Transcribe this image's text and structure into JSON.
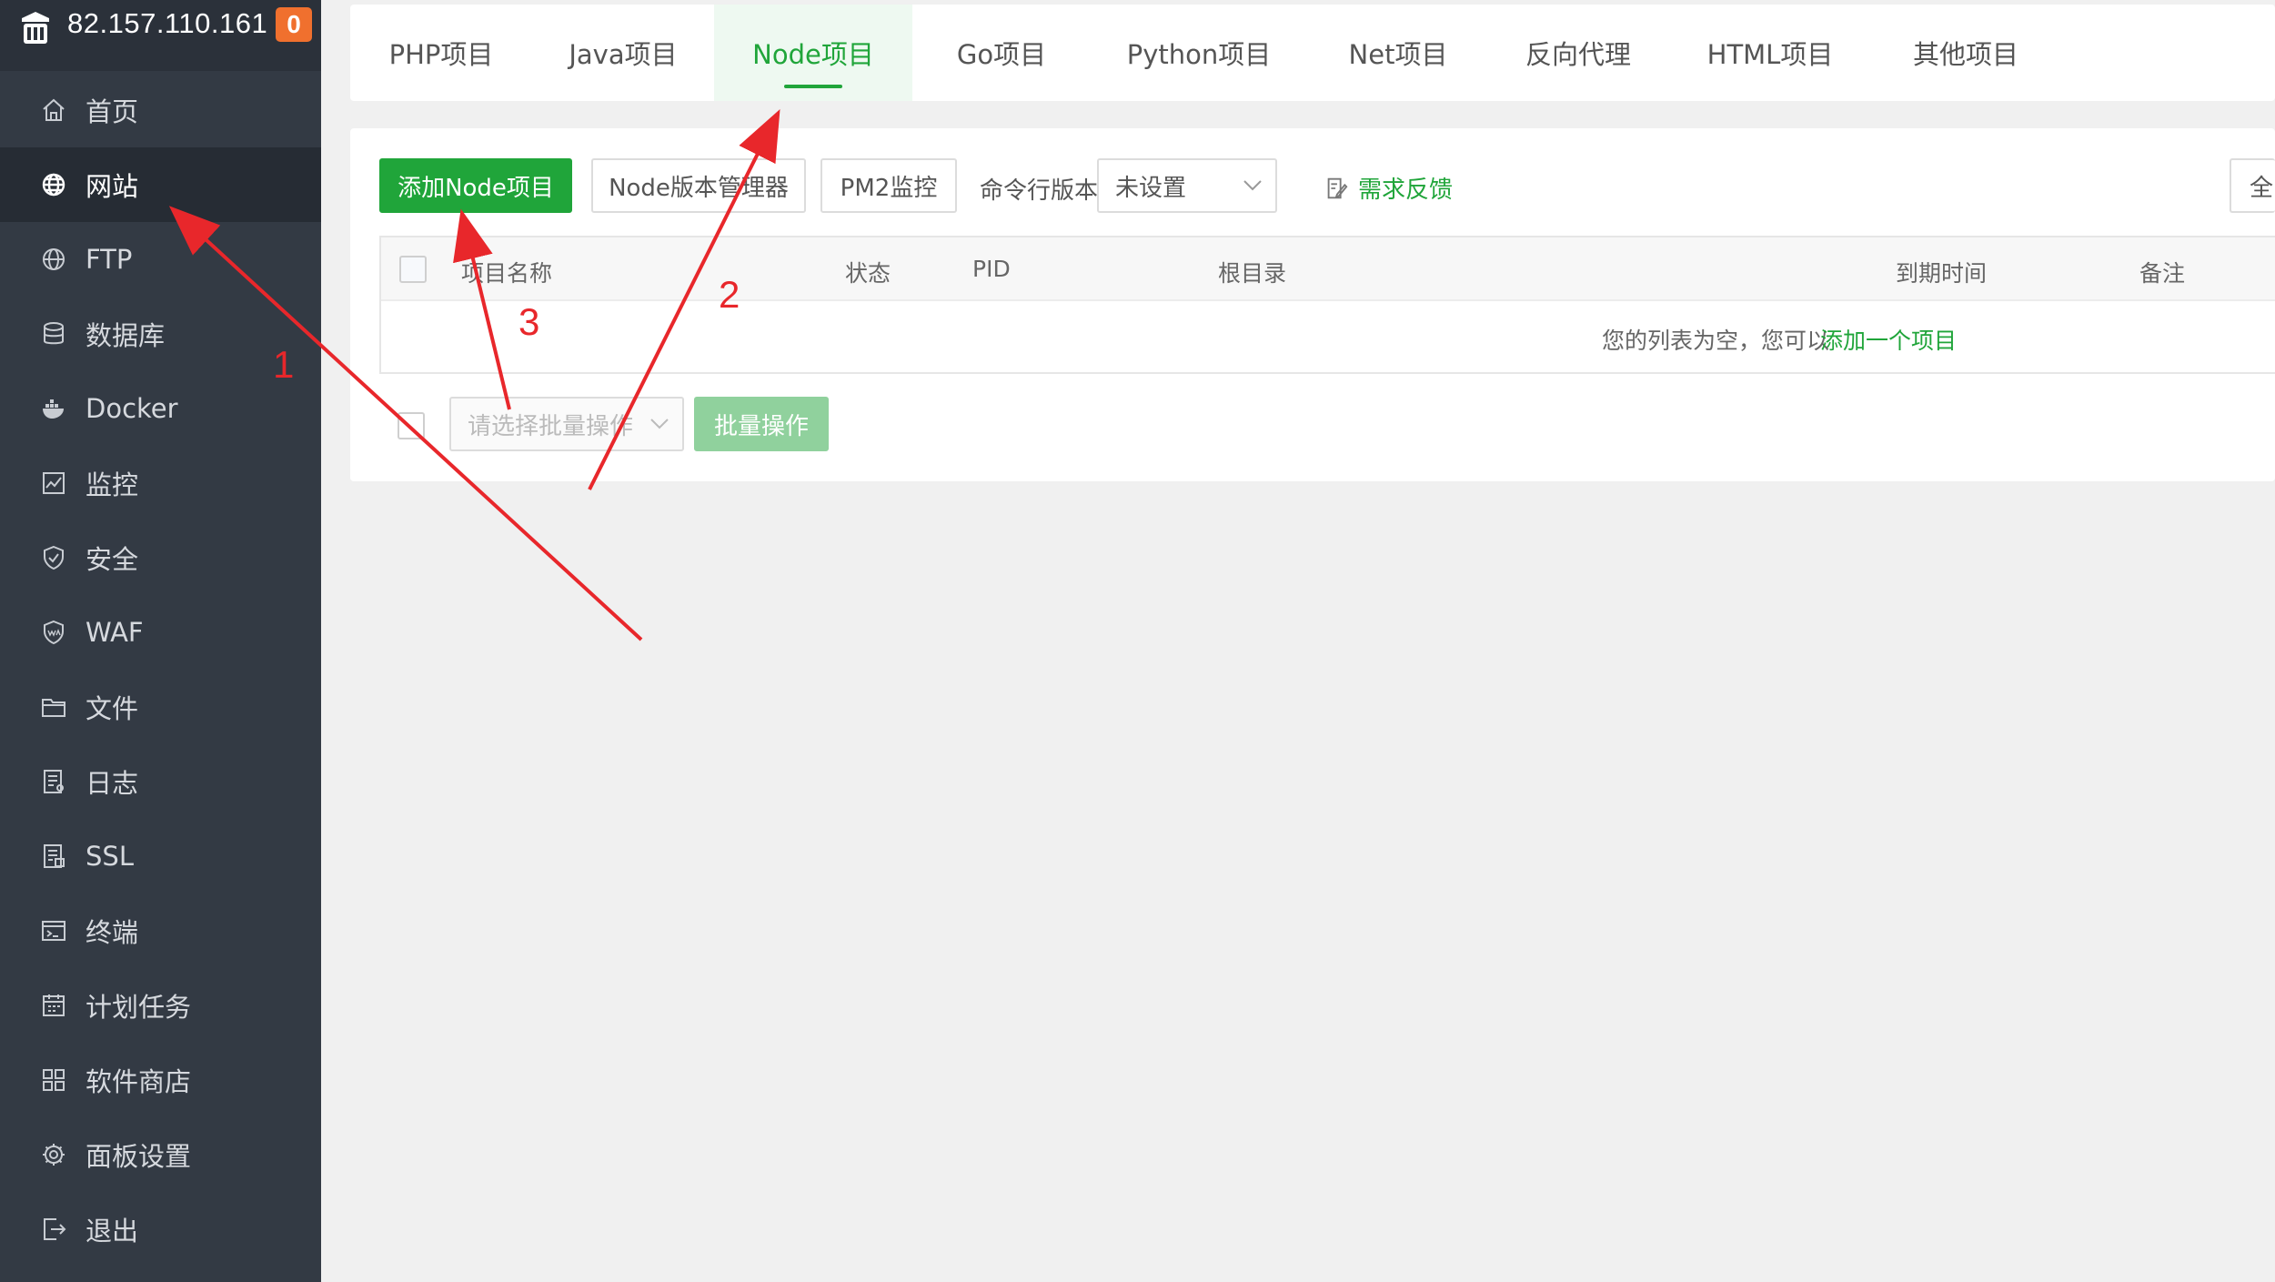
{
  "sidebar": {
    "ip": "82.157.110.161",
    "badge": "0",
    "items": [
      {
        "label": "首页",
        "icon": "home-icon"
      },
      {
        "label": "网站",
        "icon": "globe-icon",
        "active": true
      },
      {
        "label": "FTP",
        "icon": "ftp-icon"
      },
      {
        "label": "数据库",
        "icon": "database-icon"
      },
      {
        "label": "Docker",
        "icon": "docker-icon"
      },
      {
        "label": "监控",
        "icon": "monitor-icon"
      },
      {
        "label": "安全",
        "icon": "shield-icon"
      },
      {
        "label": "WAF",
        "icon": "waf-shield-icon"
      },
      {
        "label": "文件",
        "icon": "folder-icon"
      },
      {
        "label": "日志",
        "icon": "log-icon"
      },
      {
        "label": "SSL",
        "icon": "ssl-icon"
      },
      {
        "label": "终端",
        "icon": "terminal-icon"
      },
      {
        "label": "计划任务",
        "icon": "calendar-icon"
      },
      {
        "label": "软件商店",
        "icon": "apps-icon"
      },
      {
        "label": "面板设置",
        "icon": "gear-icon"
      },
      {
        "label": "退出",
        "icon": "logout-icon"
      }
    ]
  },
  "tabs": [
    {
      "label": "PHP项目"
    },
    {
      "label": "Java项目"
    },
    {
      "label": "Node项目",
      "active": true
    },
    {
      "label": "Go项目"
    },
    {
      "label": "Python项目"
    },
    {
      "label": "Net项目"
    },
    {
      "label": "反向代理"
    },
    {
      "label": "HTML项目"
    },
    {
      "label": "其他项目"
    }
  ],
  "toolbar": {
    "add_label": "添加Node项目",
    "version_manager_label": "Node版本管理器",
    "pm2_label": "PM2监控",
    "cli_version_label": "命令行版本",
    "cli_version_value": "未设置",
    "feedback_label": "需求反馈",
    "right_button_partial": "全"
  },
  "table": {
    "columns": [
      "项目名称",
      "状态",
      "PID",
      "根目录",
      "到期时间",
      "备注"
    ],
    "empty_text": "您的列表为空，您可以",
    "empty_link": "添加一个项目"
  },
  "batch": {
    "placeholder": "请选择批量操作",
    "button_label": "批量操作"
  },
  "annotations": {
    "numbers": [
      "1",
      "2",
      "3"
    ],
    "color": "#e8272b"
  },
  "colors": {
    "accent": "#20a53a",
    "sidebar_bg": "#333a44",
    "badge": "#f0702e"
  }
}
